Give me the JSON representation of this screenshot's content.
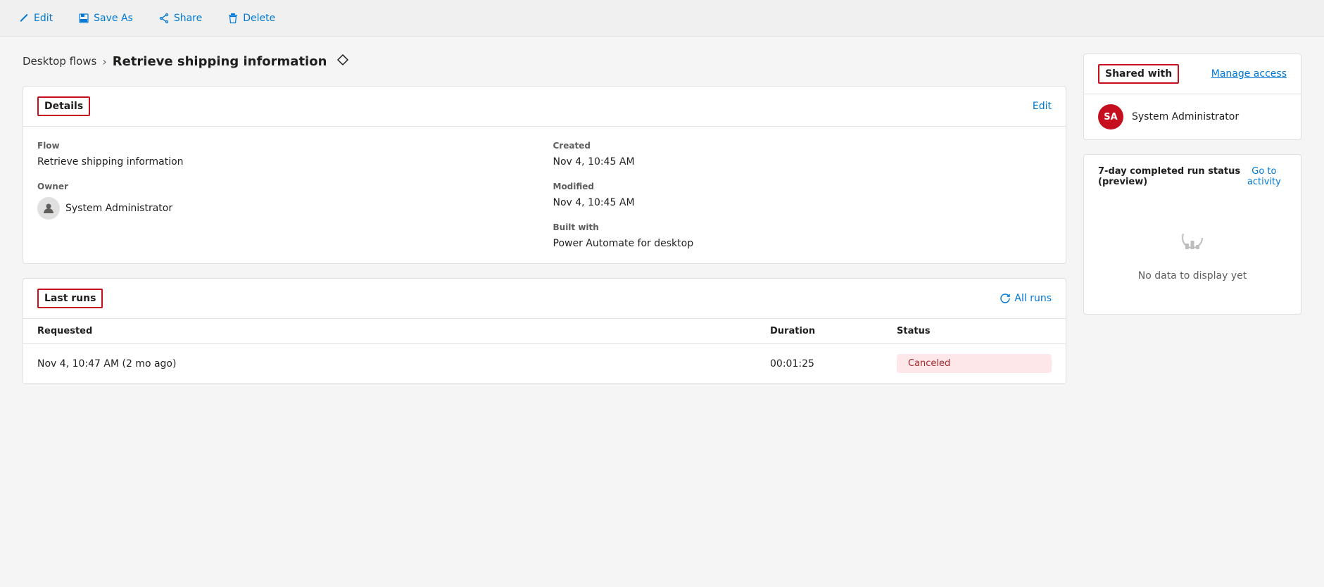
{
  "toolbar": {
    "edit_label": "Edit",
    "save_as_label": "Save As",
    "share_label": "Share",
    "delete_label": "Delete"
  },
  "breadcrumb": {
    "parent_label": "Desktop flows",
    "separator": ">",
    "current_label": "Retrieve shipping information"
  },
  "details_card": {
    "title": "Details",
    "edit_link": "Edit",
    "flow_label": "Flow",
    "flow_value": "Retrieve shipping information",
    "owner_label": "Owner",
    "owner_value": "System Administrator",
    "created_label": "Created",
    "created_value": "Nov 4, 10:45 AM",
    "modified_label": "Modified",
    "modified_value": "Nov 4, 10:45 AM",
    "built_with_label": "Built with",
    "built_with_value": "Power Automate for desktop"
  },
  "last_runs_card": {
    "title": "Last runs",
    "all_runs_link": "All runs",
    "col_requested": "Requested",
    "col_duration": "Duration",
    "col_status": "Status",
    "rows": [
      {
        "requested": "Nov 4, 10:47 AM (2 mo ago)",
        "duration": "00:01:25",
        "status": "Canceled"
      }
    ]
  },
  "shared_with_card": {
    "title": "Shared with",
    "manage_access_link": "Manage access",
    "user_initials": "SA",
    "user_name": "System Administrator"
  },
  "activity_card": {
    "title": "7-day completed run status (preview)",
    "go_to_activity_link": "Go to activity",
    "no_data_label": "No data to display yet"
  }
}
